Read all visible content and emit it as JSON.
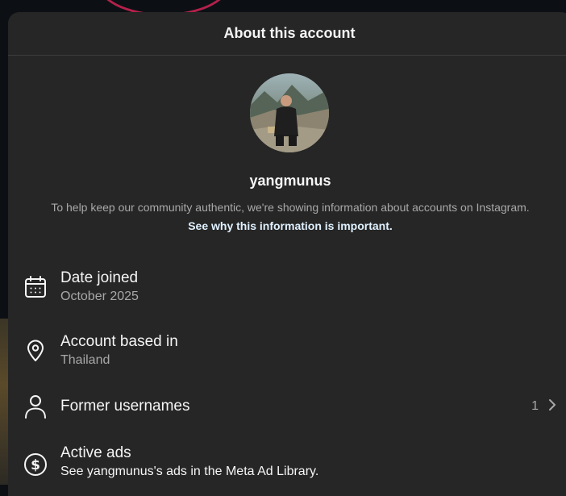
{
  "modal": {
    "title": "About this account"
  },
  "profile": {
    "username": "yangmunus",
    "avatar_icon": "profile-photo"
  },
  "intro": {
    "text": "To help keep our community authentic, we're showing information about accounts on Instagram.",
    "link": "See why this information is important."
  },
  "rows": [
    {
      "icon": "calendar-icon",
      "label": "Date joined",
      "value": "October 2025"
    },
    {
      "icon": "location-pin-icon",
      "label": "Account based in",
      "value": "Thailand"
    },
    {
      "icon": "person-icon",
      "label": "Former usernames",
      "count": "1",
      "chevron_icon": "chevron-right-icon"
    },
    {
      "icon": "dollar-circle-icon",
      "label": "Active ads",
      "value": "See yangmunus's ads in the Meta Ad Library."
    }
  ],
  "colors": {
    "modal_bg": "#262626",
    "page_bg": "#0c1014",
    "text_primary": "#f5f5f5",
    "text_secondary": "#a8a8a8",
    "link": "#e0f1ff"
  }
}
